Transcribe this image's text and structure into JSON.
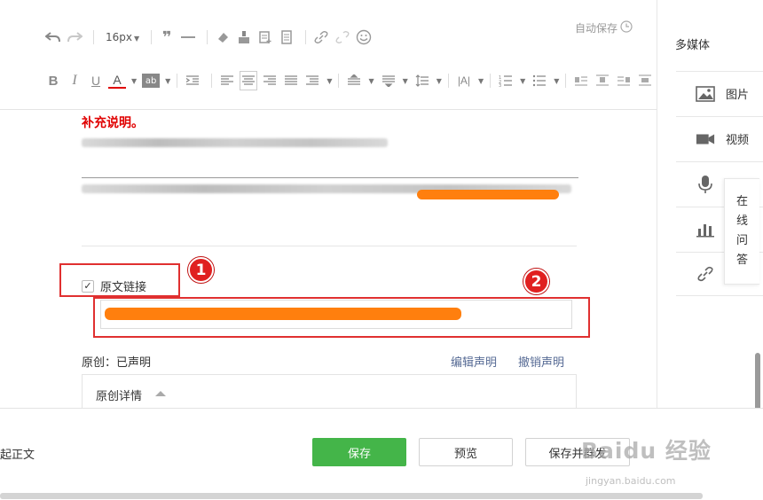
{
  "toolbar": {
    "font_size": "16px",
    "autosave_label": "自动保存"
  },
  "content": {
    "red_title": "补充说明。"
  },
  "original_link": {
    "checkbox_label": "原文链接",
    "checked_mark": "✓"
  },
  "originality": {
    "status": "原创：已声明",
    "edit_link": "编辑声明",
    "cancel_link": "撤销声明",
    "details_label": "原创详情"
  },
  "annotations": {
    "one": "1",
    "two": "2"
  },
  "sidebar": {
    "title": "多媒体",
    "items": [
      {
        "label": "图片",
        "icon": "image-icon"
      },
      {
        "label": "视频",
        "icon": "video-icon"
      },
      {
        "label": "",
        "icon": "microphone-icon"
      },
      {
        "label": "",
        "icon": "chart-icon"
      },
      {
        "label": "",
        "icon": "link-icon"
      }
    ],
    "online_qa": [
      "在",
      "线",
      "问",
      "答"
    ]
  },
  "footer": {
    "left_text": "起正文",
    "save": "保存",
    "preview": "预览",
    "save_and_send": "保存并群发",
    "watermark": "Baidu 经验",
    "watermark_sub": "jingyan.baidu.com"
  },
  "colors": {
    "accent_green": "#44b549",
    "annotation_red": "#e02020",
    "link_blue": "#576b95",
    "highlight_orange": "#ff7f0e"
  }
}
